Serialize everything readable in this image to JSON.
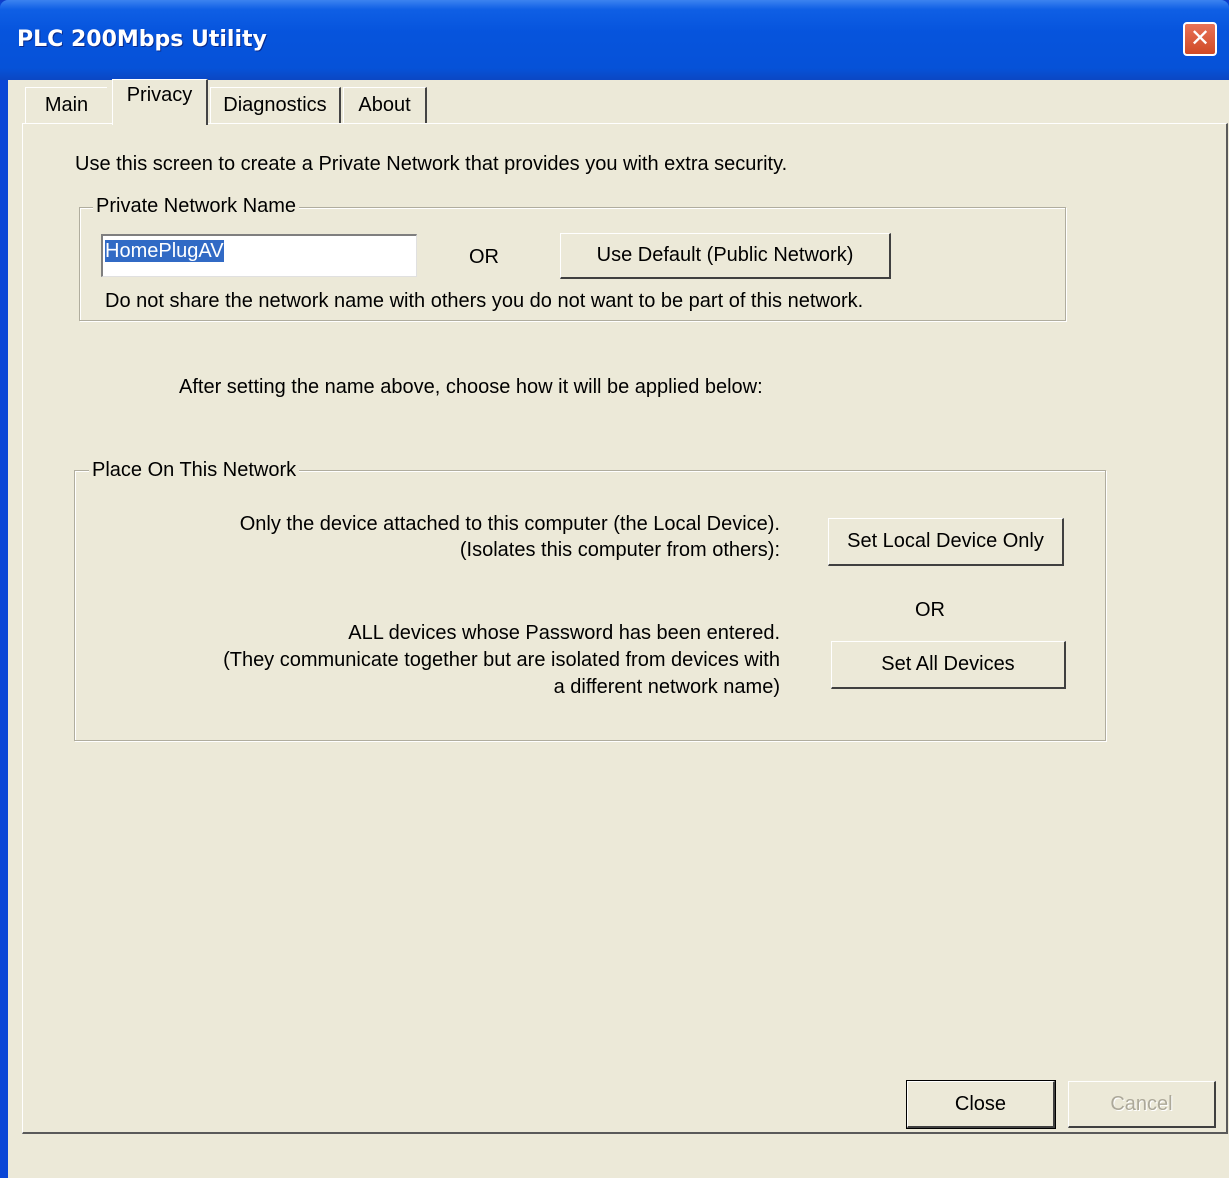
{
  "window": {
    "title": "PLC 200Mbps Utility",
    "close_glyph": "✕"
  },
  "tabs": [
    {
      "label": "Main",
      "active": false
    },
    {
      "label": "Privacy",
      "active": true
    },
    {
      "label": "Diagnostics",
      "active": false
    },
    {
      "label": "About",
      "active": false
    }
  ],
  "privacy": {
    "intro": "Use this screen to create a Private Network that provides you with extra security.",
    "network_name_group": {
      "legend": "Private Network Name",
      "input_value": "HomePlugAV",
      "or_label": "OR",
      "default_button": "Use Default (Public Network)",
      "warning": "Do not share the network name with others you do not want to be part of this network."
    },
    "apply_hint": "After setting the name above, choose how it will be applied below:",
    "place_group": {
      "legend": "Place On This Network",
      "local_line1": "Only the device attached to this computer (the Local Device).",
      "local_line2": "(Isolates this computer from others):",
      "local_button": "Set Local Device Only",
      "or_label": "OR",
      "all_line1": "ALL devices whose Password has been entered.",
      "all_line2": "(They communicate together but are isolated from devices with",
      "all_line3": "a different network name)",
      "all_button": "Set All Devices"
    }
  },
  "footer": {
    "close_button": "Close",
    "cancel_button": "Cancel"
  },
  "colors": {
    "titlebar": "#0654dd",
    "dialog_face": "#ece9d8",
    "selection": "#316ac5",
    "close_button": "#d04a26"
  }
}
